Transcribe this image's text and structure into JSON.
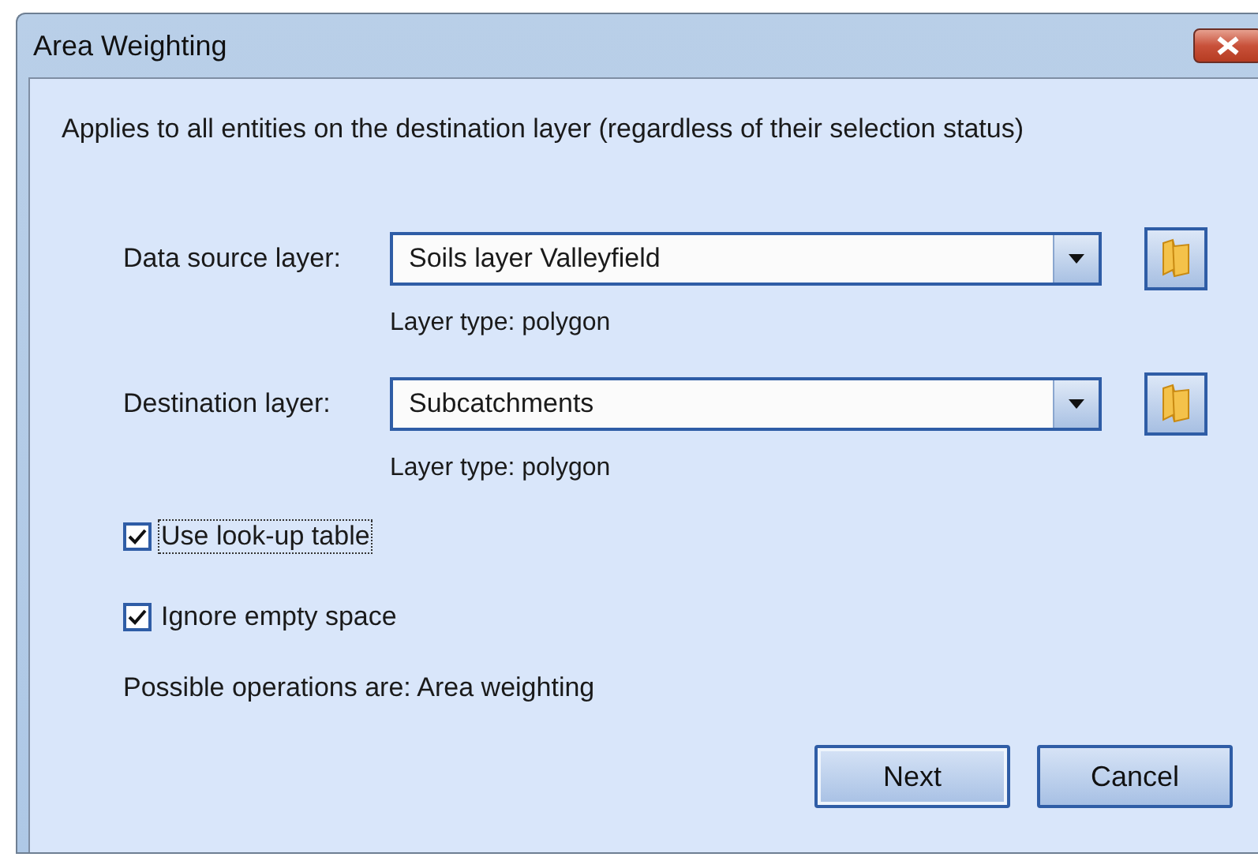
{
  "window": {
    "title": "Area Weighting"
  },
  "description": "Applies to all entities on the destination layer (regardless of their selection status)",
  "layers": [
    {
      "label": "Data source layer:",
      "value": "Soils layer Valleyfield",
      "layer_type": "Layer type: polygon"
    },
    {
      "label": "Destination layer:",
      "value": "Subcatchments",
      "layer_type": "Layer type: polygon"
    }
  ],
  "options": [
    {
      "label": "Use look-up table",
      "checked": true,
      "focused": true
    },
    {
      "label": "Ignore empty space",
      "checked": true,
      "focused": false
    }
  ],
  "operations": "Possible operations are: Area weighting",
  "buttons": [
    {
      "label": "Next",
      "default": true
    },
    {
      "label": "Cancel",
      "default": false
    }
  ]
}
